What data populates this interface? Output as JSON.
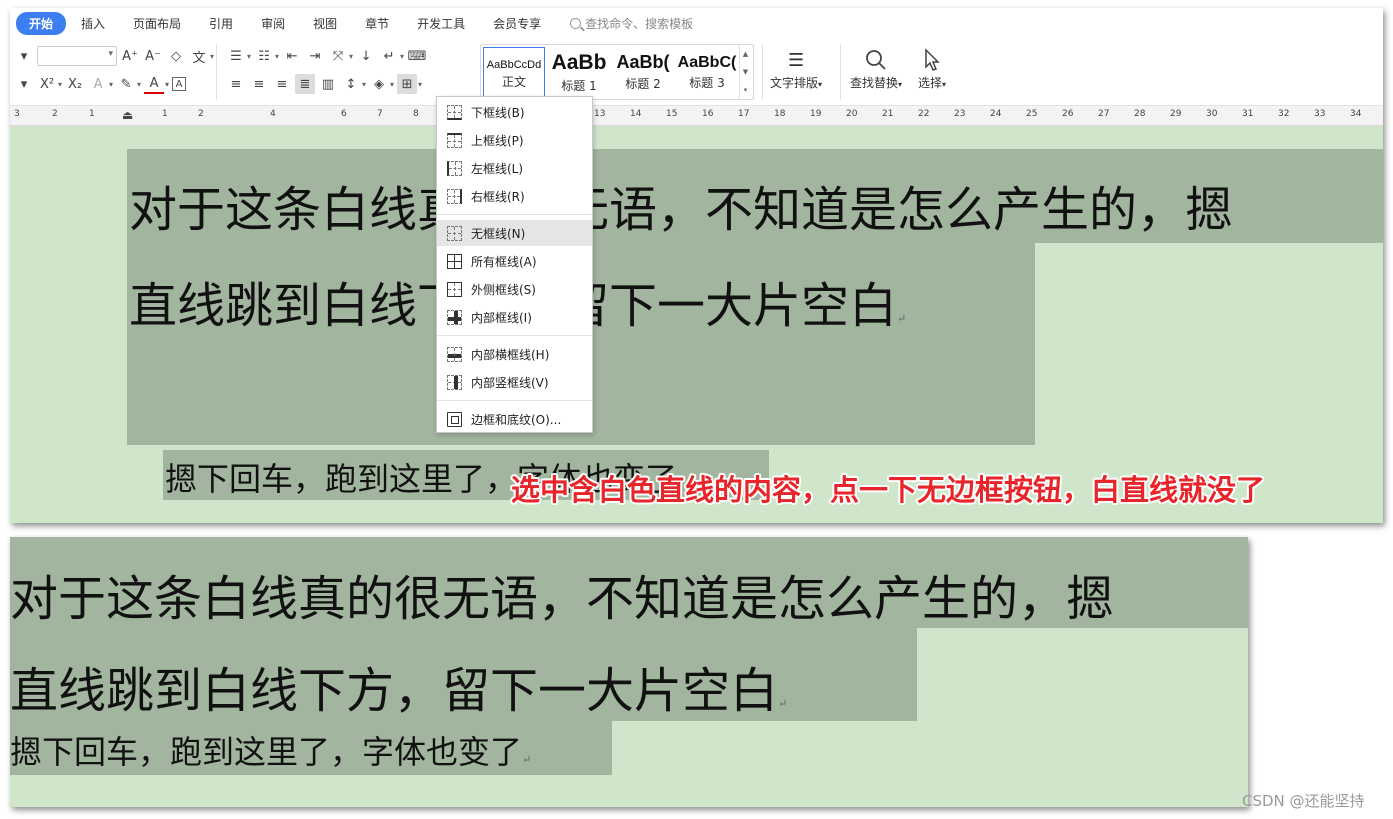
{
  "menubar": {
    "tabs": [
      "开始",
      "插入",
      "页面布局",
      "引用",
      "审阅",
      "视图",
      "章节",
      "开发工具",
      "会员专享"
    ],
    "search_text": "查找命令、搜索模板"
  },
  "ribbon": {
    "styles": [
      {
        "sample": "AaBbCcDd",
        "name": "正文"
      },
      {
        "sample": "AaBb",
        "name": "标题 1"
      },
      {
        "sample": "AaBb(",
        "name": "标题 2"
      },
      {
        "sample": "AaBbC(",
        "name": "标题 3"
      }
    ],
    "text_layout_label": "文字排版",
    "find_replace_label": "查找替换",
    "select_label": "选择"
  },
  "ruler": {
    "numbers": [
      "3",
      "2",
      "1",
      "1",
      "2",
      "4",
      "6",
      "7",
      "8",
      "13",
      "14",
      "15",
      "16",
      "17",
      "18",
      "19",
      "20",
      "21",
      "22",
      "23",
      "24",
      "25",
      "26",
      "27",
      "28",
      "29",
      "30",
      "31",
      "32",
      "33",
      "34"
    ]
  },
  "border_menu": {
    "items": [
      {
        "label": "下框线(B)"
      },
      {
        "label": "上框线(P)"
      },
      {
        "label": "左框线(L)"
      },
      {
        "label": "右框线(R)"
      },
      {
        "label": "无框线(N)"
      },
      {
        "label": "所有框线(A)"
      },
      {
        "label": "外侧框线(S)"
      },
      {
        "label": "内部框线(I)"
      },
      {
        "label": "内部横框线(H)"
      },
      {
        "label": "内部竖框线(V)"
      },
      {
        "label": "边框和底纹(O)..."
      }
    ]
  },
  "top_doc": {
    "line1": "对于这条白线真的很无语，不知道是怎么产生的，摁",
    "line2": "直线跳到白线下方，留下一大片空白",
    "line3": "摁下回车，跑到这里了，字体也变了"
  },
  "annotation": "选中含白色直线的内容，点一下无边框按钮，白直线就没了",
  "bottom_doc": {
    "line1": "对于这条白线真的很无语，不知道是怎么产生的，摁",
    "line2": "直线跳到白线下方，留下一大片空白",
    "line3": "摁下回车，跑到这里了，字体也变了"
  },
  "watermark": "CSDN @还能坚持",
  "colors": {
    "page_background": "#cfe6cb",
    "selection_highlight": "#a2b59f",
    "annotation_text": "#e8252a",
    "active_tab": "#3d7ef1"
  }
}
